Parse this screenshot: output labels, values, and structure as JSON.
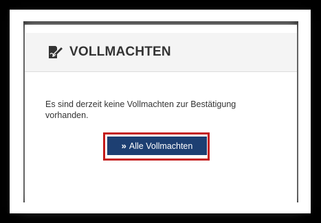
{
  "panel": {
    "title": "VOLLMACHTEN",
    "icon": "signature-edit-icon",
    "message": "Es sind derzeit keine Vollmachten zur Bestätigung vorhanden.",
    "button": {
      "icon": "»",
      "label": "Alle Vollmachten"
    }
  },
  "colors": {
    "button_bg": "#1d3f72",
    "highlight": "#c41a1a",
    "header_bg": "#f4f4f4",
    "frame": "#000000"
  }
}
